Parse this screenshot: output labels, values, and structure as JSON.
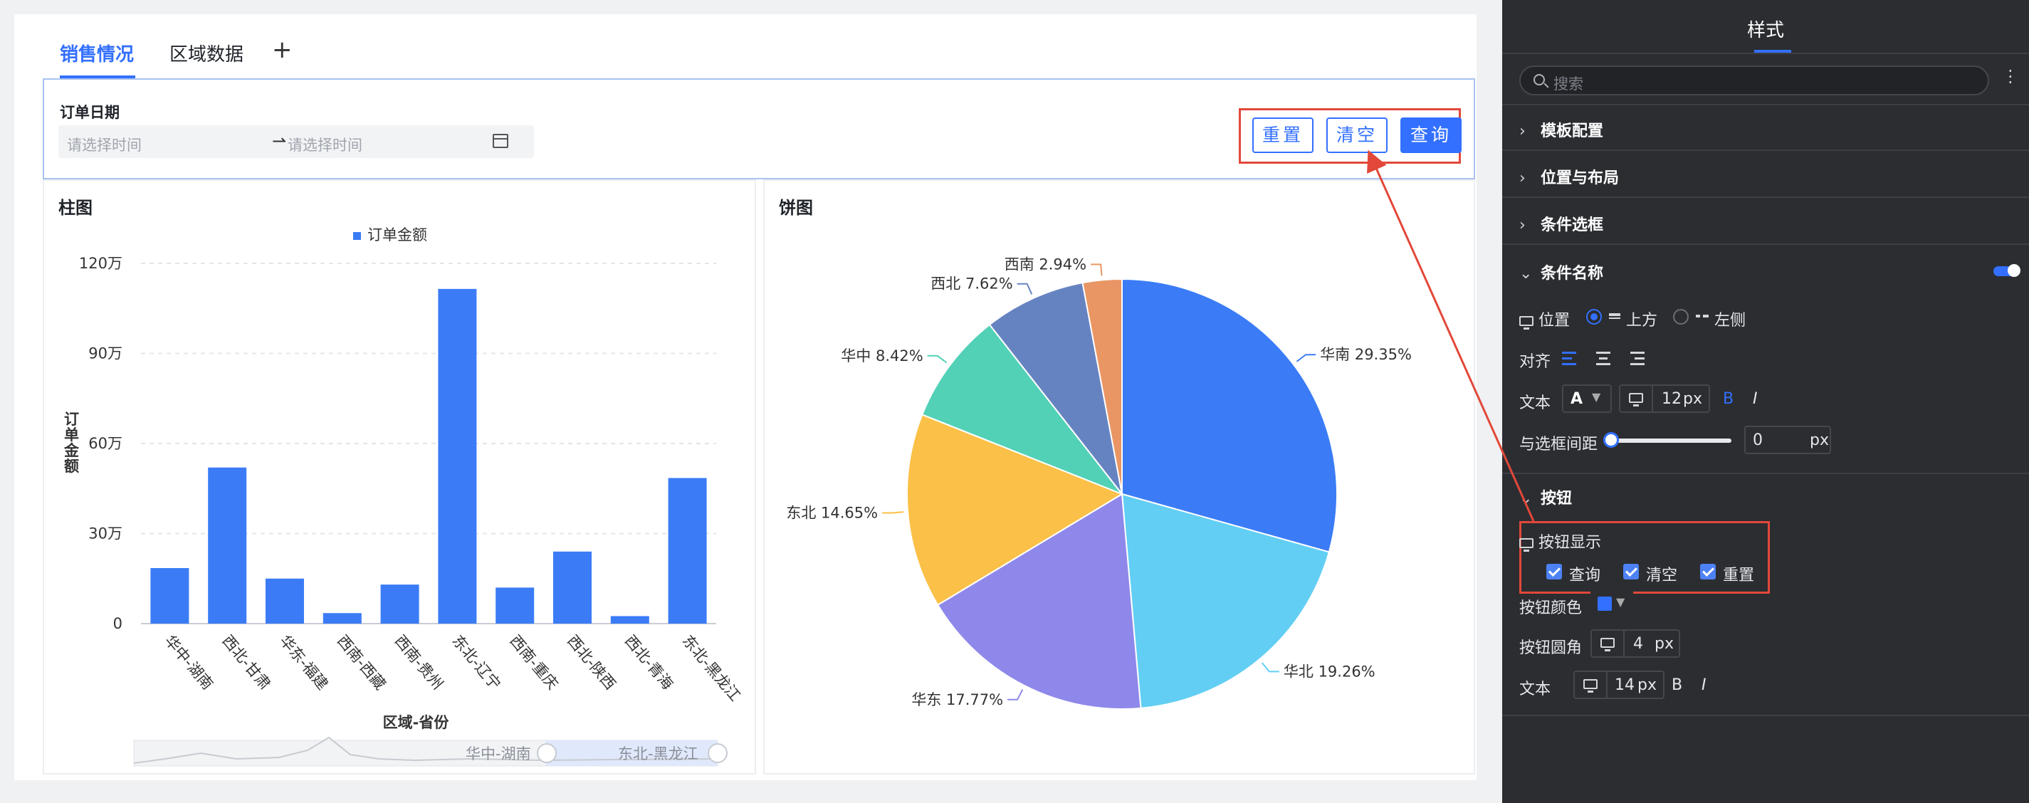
{
  "tabs": [
    {
      "label": "销售情况",
      "active": true
    },
    {
      "label": "区域数据",
      "active": false
    }
  ],
  "tab_add_label": "+",
  "filter": {
    "label": "订单日期",
    "start_placeholder": "请选择时间",
    "end_placeholder": "请选择时间",
    "range_arrow": "⇀",
    "buttons": {
      "reset": "重置",
      "clear": "清空",
      "query": "查询"
    }
  },
  "bar_panel": {
    "title": "柱图",
    "zoom_start_label": "华中-湖南",
    "zoom_end_label": "东北-黑龙江"
  },
  "pie_panel": {
    "title": "饼图"
  },
  "chart_data": [
    {
      "type": "bar",
      "legend": [
        "订单金额"
      ],
      "legend_position": "top-center",
      "categories": [
        "华中-湖南",
        "西北-甘肃",
        "华东-福建",
        "西南-西藏",
        "西南-贵州",
        "东北-辽宁",
        "西南-重庆",
        "西北-陕西",
        "西北-青海",
        "东北-黑龙江"
      ],
      "series": [
        {
          "name": "订单金额",
          "values": [
            18.5,
            52,
            15,
            3.5,
            13,
            111.5,
            12,
            24,
            2.5,
            48.5
          ]
        }
      ],
      "yticks": [
        "0",
        "30万",
        "60万",
        "90万",
        "120万"
      ],
      "ylim": [
        0,
        120
      ],
      "xlabel": "区域-省份",
      "ylabel": "订单金额",
      "grid": true,
      "color": "#3b7cf6"
    },
    {
      "type": "pie",
      "slices": [
        {
          "label": "华南",
          "value": 29.35,
          "display": "华南 29.35%",
          "color": "#3b7cf6"
        },
        {
          "label": "华北",
          "value": 19.26,
          "display": "华北 19.26%",
          "color": "#62cef3"
        },
        {
          "label": "华东",
          "value": 17.77,
          "display": "华东 17.77%",
          "color": "#8e88ea"
        },
        {
          "label": "东北",
          "value": 14.65,
          "display": "东北 14.65%",
          "color": "#fbc047"
        },
        {
          "label": "华中",
          "value": 8.42,
          "display": "华中 8.42%",
          "color": "#52d1b7"
        },
        {
          "label": "西北",
          "value": 7.62,
          "display": "西北 7.62%",
          "color": "#6683c1"
        },
        {
          "label": "西南",
          "value": 2.94,
          "display": "西南 2.94%",
          "color": "#e99664"
        }
      ]
    }
  ],
  "sidebar": {
    "title": "样式",
    "search_placeholder": "搜索",
    "sections": {
      "template": "模板配置",
      "position_layout": "位置与布局",
      "condition_box": "条件选框",
      "condition_name": "条件名称",
      "button": "按钮"
    },
    "condition_name": {
      "position_label": "位置",
      "opt_top": "上方",
      "opt_left": "左侧",
      "align_label": "对齐",
      "text_label": "文本",
      "font_color_glyph": "A",
      "font_size": "12",
      "unit": "px",
      "bold": "B",
      "italic": "I",
      "gap_label": "与选框间距",
      "gap_value": "0",
      "gap_unit": "px"
    },
    "button": {
      "display_label": "按钮显示",
      "checks": [
        "查询",
        "清空",
        "重置"
      ],
      "color_label": "按钮颜色",
      "color_value": "#3370ff",
      "radius_label": "按钮圆角",
      "radius_value": "4",
      "radius_unit": "px",
      "text_label": "文本",
      "font_size": "14",
      "font_unit": "px",
      "bold": "B",
      "italic": "I"
    }
  }
}
